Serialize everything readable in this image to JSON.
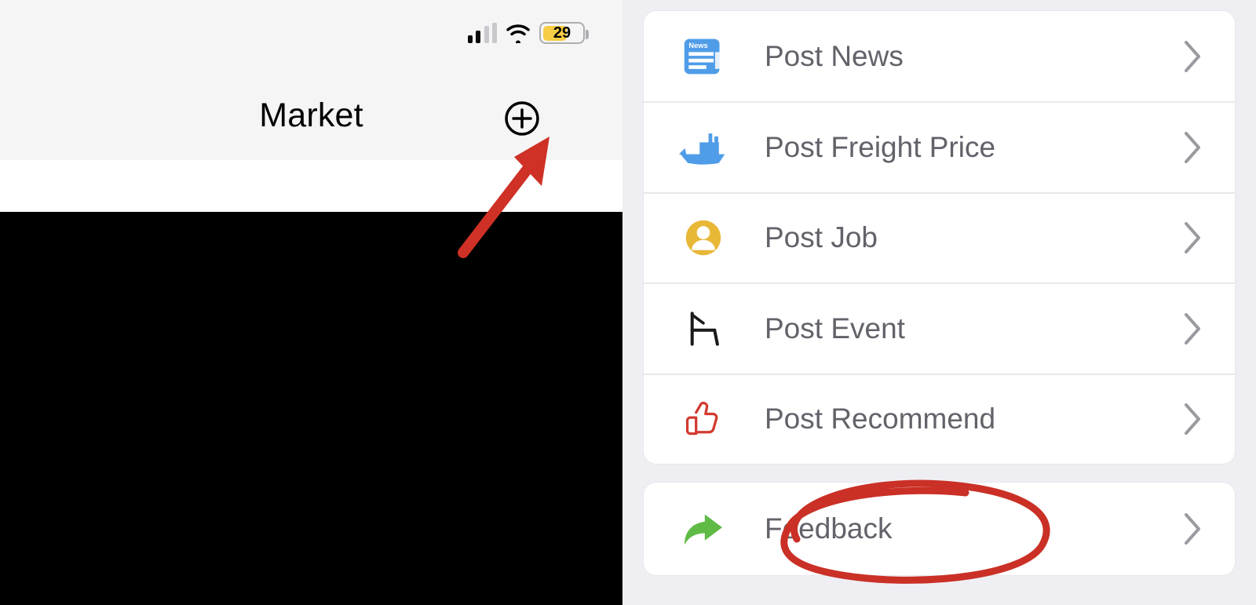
{
  "status_bar": {
    "battery_percent": "29"
  },
  "header": {
    "title": "Market"
  },
  "menu": {
    "groups": [
      {
        "items": [
          {
            "label": "Post News"
          },
          {
            "label": "Post Freight Price"
          },
          {
            "label": "Post Job"
          },
          {
            "label": "Post Event"
          },
          {
            "label": "Post Recommend"
          }
        ]
      },
      {
        "items": [
          {
            "label": "Feedback"
          }
        ]
      }
    ]
  },
  "colors": {
    "blue": "#4f9de8",
    "yellow": "#e8b736",
    "red": "#d23a30",
    "green": "#5fbb46",
    "battery_yellow": "#f7cd46",
    "label_gray": "#62626a",
    "panel_gray": "#efeff3"
  }
}
